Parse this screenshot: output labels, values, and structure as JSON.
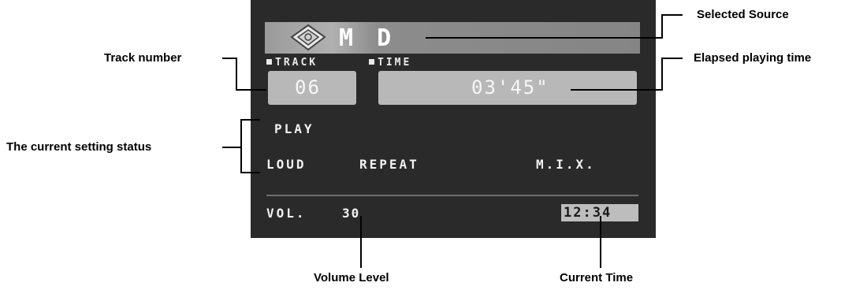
{
  "display": {
    "source_label": "M D",
    "track_label": "TRACK",
    "time_label": "TIME",
    "track_value": "06",
    "time_value": "03'45\"",
    "status_play": "PLAY",
    "status_loud": "LOUD",
    "status_repeat": "REPEAT",
    "status_mix": "M.I.X.",
    "volume_label": "VOL.",
    "volume_value": "30",
    "clock": "12:34"
  },
  "callouts": {
    "selected_source": "Selected Source",
    "elapsed_time": "Elapsed playing time",
    "track_number": "Track number",
    "setting_status": "The current setting status",
    "volume_level": "Volume Level",
    "current_time": "Current Time"
  },
  "colors": {
    "screen_bg": "#2a2a2a",
    "lcd_text": "#f2f2f2",
    "box_bg": "#b8b8b8"
  }
}
